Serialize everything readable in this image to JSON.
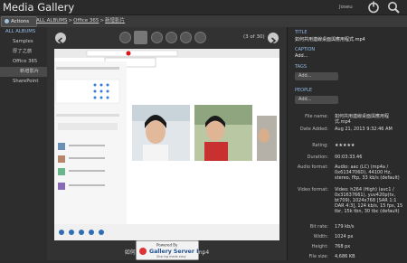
{
  "app": {
    "title": "Media Gallery",
    "user": "Joseu"
  },
  "toolbar": {
    "actions_label": "Actions",
    "breadcrumb": [
      "ALL ALBUMS",
      "Office 365",
      "新增影片"
    ]
  },
  "tree": {
    "items": [
      {
        "label": "ALL ALBUMS",
        "level": 0
      },
      {
        "label": "Samples",
        "level": 1
      },
      {
        "label": "厚了之旅",
        "level": 1
      },
      {
        "label": "Office 365",
        "level": 2
      },
      {
        "label": "新增影片",
        "level": 3,
        "selected": true
      },
      {
        "label": "SharePoint",
        "level": 1
      }
    ]
  },
  "viewer": {
    "counter": "(3 of 30)",
    "caption": "如何共用連線桌面與應用程式.mp4"
  },
  "branding": {
    "powered_by": "Powered By",
    "name": "Gallery Server Pro",
    "tagline": "Sharing made easy"
  },
  "metadata": {
    "title_label": "TITLE",
    "title_value": "如何共用連線桌面與應用程式.mp4",
    "caption_label": "CAPTION",
    "caption_add": "Add...",
    "tags_label": "TAGS",
    "tags_add": "Add...",
    "people_label": "PEOPLE",
    "people_add": "Add...",
    "rows": [
      {
        "k": "File name:",
        "v": "如何共用連線桌面與應用程式.mp4"
      },
      {
        "k": "Date Added:",
        "v": "Aug 21, 2013 9:32:46 AM"
      },
      {
        "k": "Rating:",
        "v": "★★★★★"
      },
      {
        "k": "Duration:",
        "v": "00:03:33.46"
      },
      {
        "k": "Audio format:",
        "v": "Audio: aac (LC) (mp4a / 0x6134706D), 44100 Hz, stereo, fltp, 33 kb/s (default)"
      },
      {
        "k": "Video format:",
        "v": "Video: h264 (High) (avc1 / 0x31637661), yuv420p(tv, bt709), 1024x768 [SAR 1:1 DAR 4:3], 124 kb/s, 15 fps, 15 tbr, 15k tbn, 30 tbc (default)"
      },
      {
        "k": "Bit rate:",
        "v": "179 kb/s"
      },
      {
        "k": "Width:",
        "v": "1024 px"
      },
      {
        "k": "Height:",
        "v": "768 px"
      },
      {
        "k": "File size:",
        "v": "4,686 KB"
      }
    ]
  },
  "colors": {
    "accent": "#8fb9e6",
    "bg": "#2b2b2b"
  }
}
